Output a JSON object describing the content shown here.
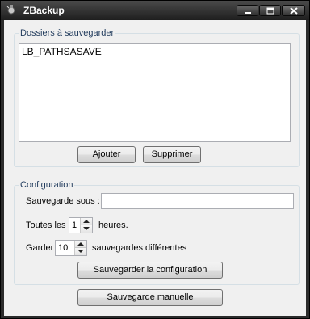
{
  "window": {
    "title": "ZBackup",
    "icons": {
      "app": "app-icon",
      "minimize": "minimize-icon",
      "maximize": "maximize-icon",
      "close": "close-icon"
    }
  },
  "folders_group": {
    "legend": "Dossiers à sauvegarder",
    "items": [
      "LB_PATHSASAVE"
    ],
    "add_label": "Ajouter",
    "remove_label": "Supprimer"
  },
  "config_group": {
    "legend": "Configuration",
    "save_as_label": "Sauvegarde sous :",
    "save_as_value": "",
    "every_label": "Toutes les",
    "every_value": "1",
    "hours_label": "heures.",
    "keep_label": "Garder",
    "keep_value": "10",
    "keep_suffix": "sauvegardes différentes",
    "save_config_label": "Sauvegarder la configuration"
  },
  "manual_backup_label": "Sauvegarde manuelle"
}
